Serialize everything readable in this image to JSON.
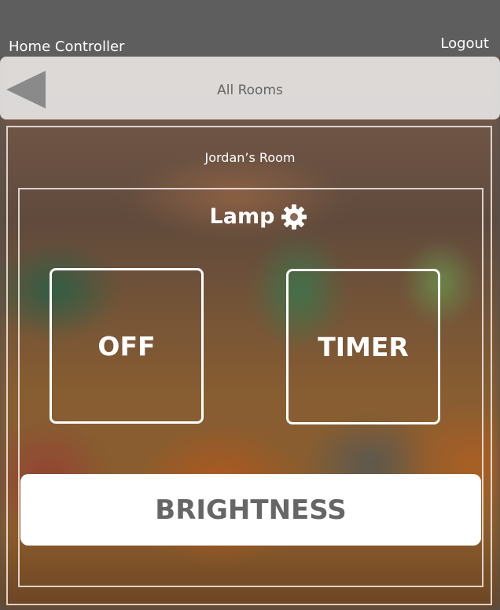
{
  "header": {
    "app_title": "Home Controller",
    "logout_label": "Logout"
  },
  "nav": {
    "title": "All Rooms",
    "back_icon": "back-triangle-icon"
  },
  "room": {
    "name": "Jordan’s Room"
  },
  "device": {
    "name": "Lamp",
    "settings_icon": "gear-icon",
    "off_label": "OFF",
    "timer_label": "TIMER",
    "brightness_label": "BRIGHTNESS"
  },
  "colors": {
    "topbar": "#5e5e5e",
    "navbar": "#ebebeb",
    "nav_text": "#666666",
    "tile_border": "#ffffff",
    "brightness_bg": "#ffffff",
    "brightness_text": "#666666",
    "back_icon": "#8a8a8a"
  }
}
